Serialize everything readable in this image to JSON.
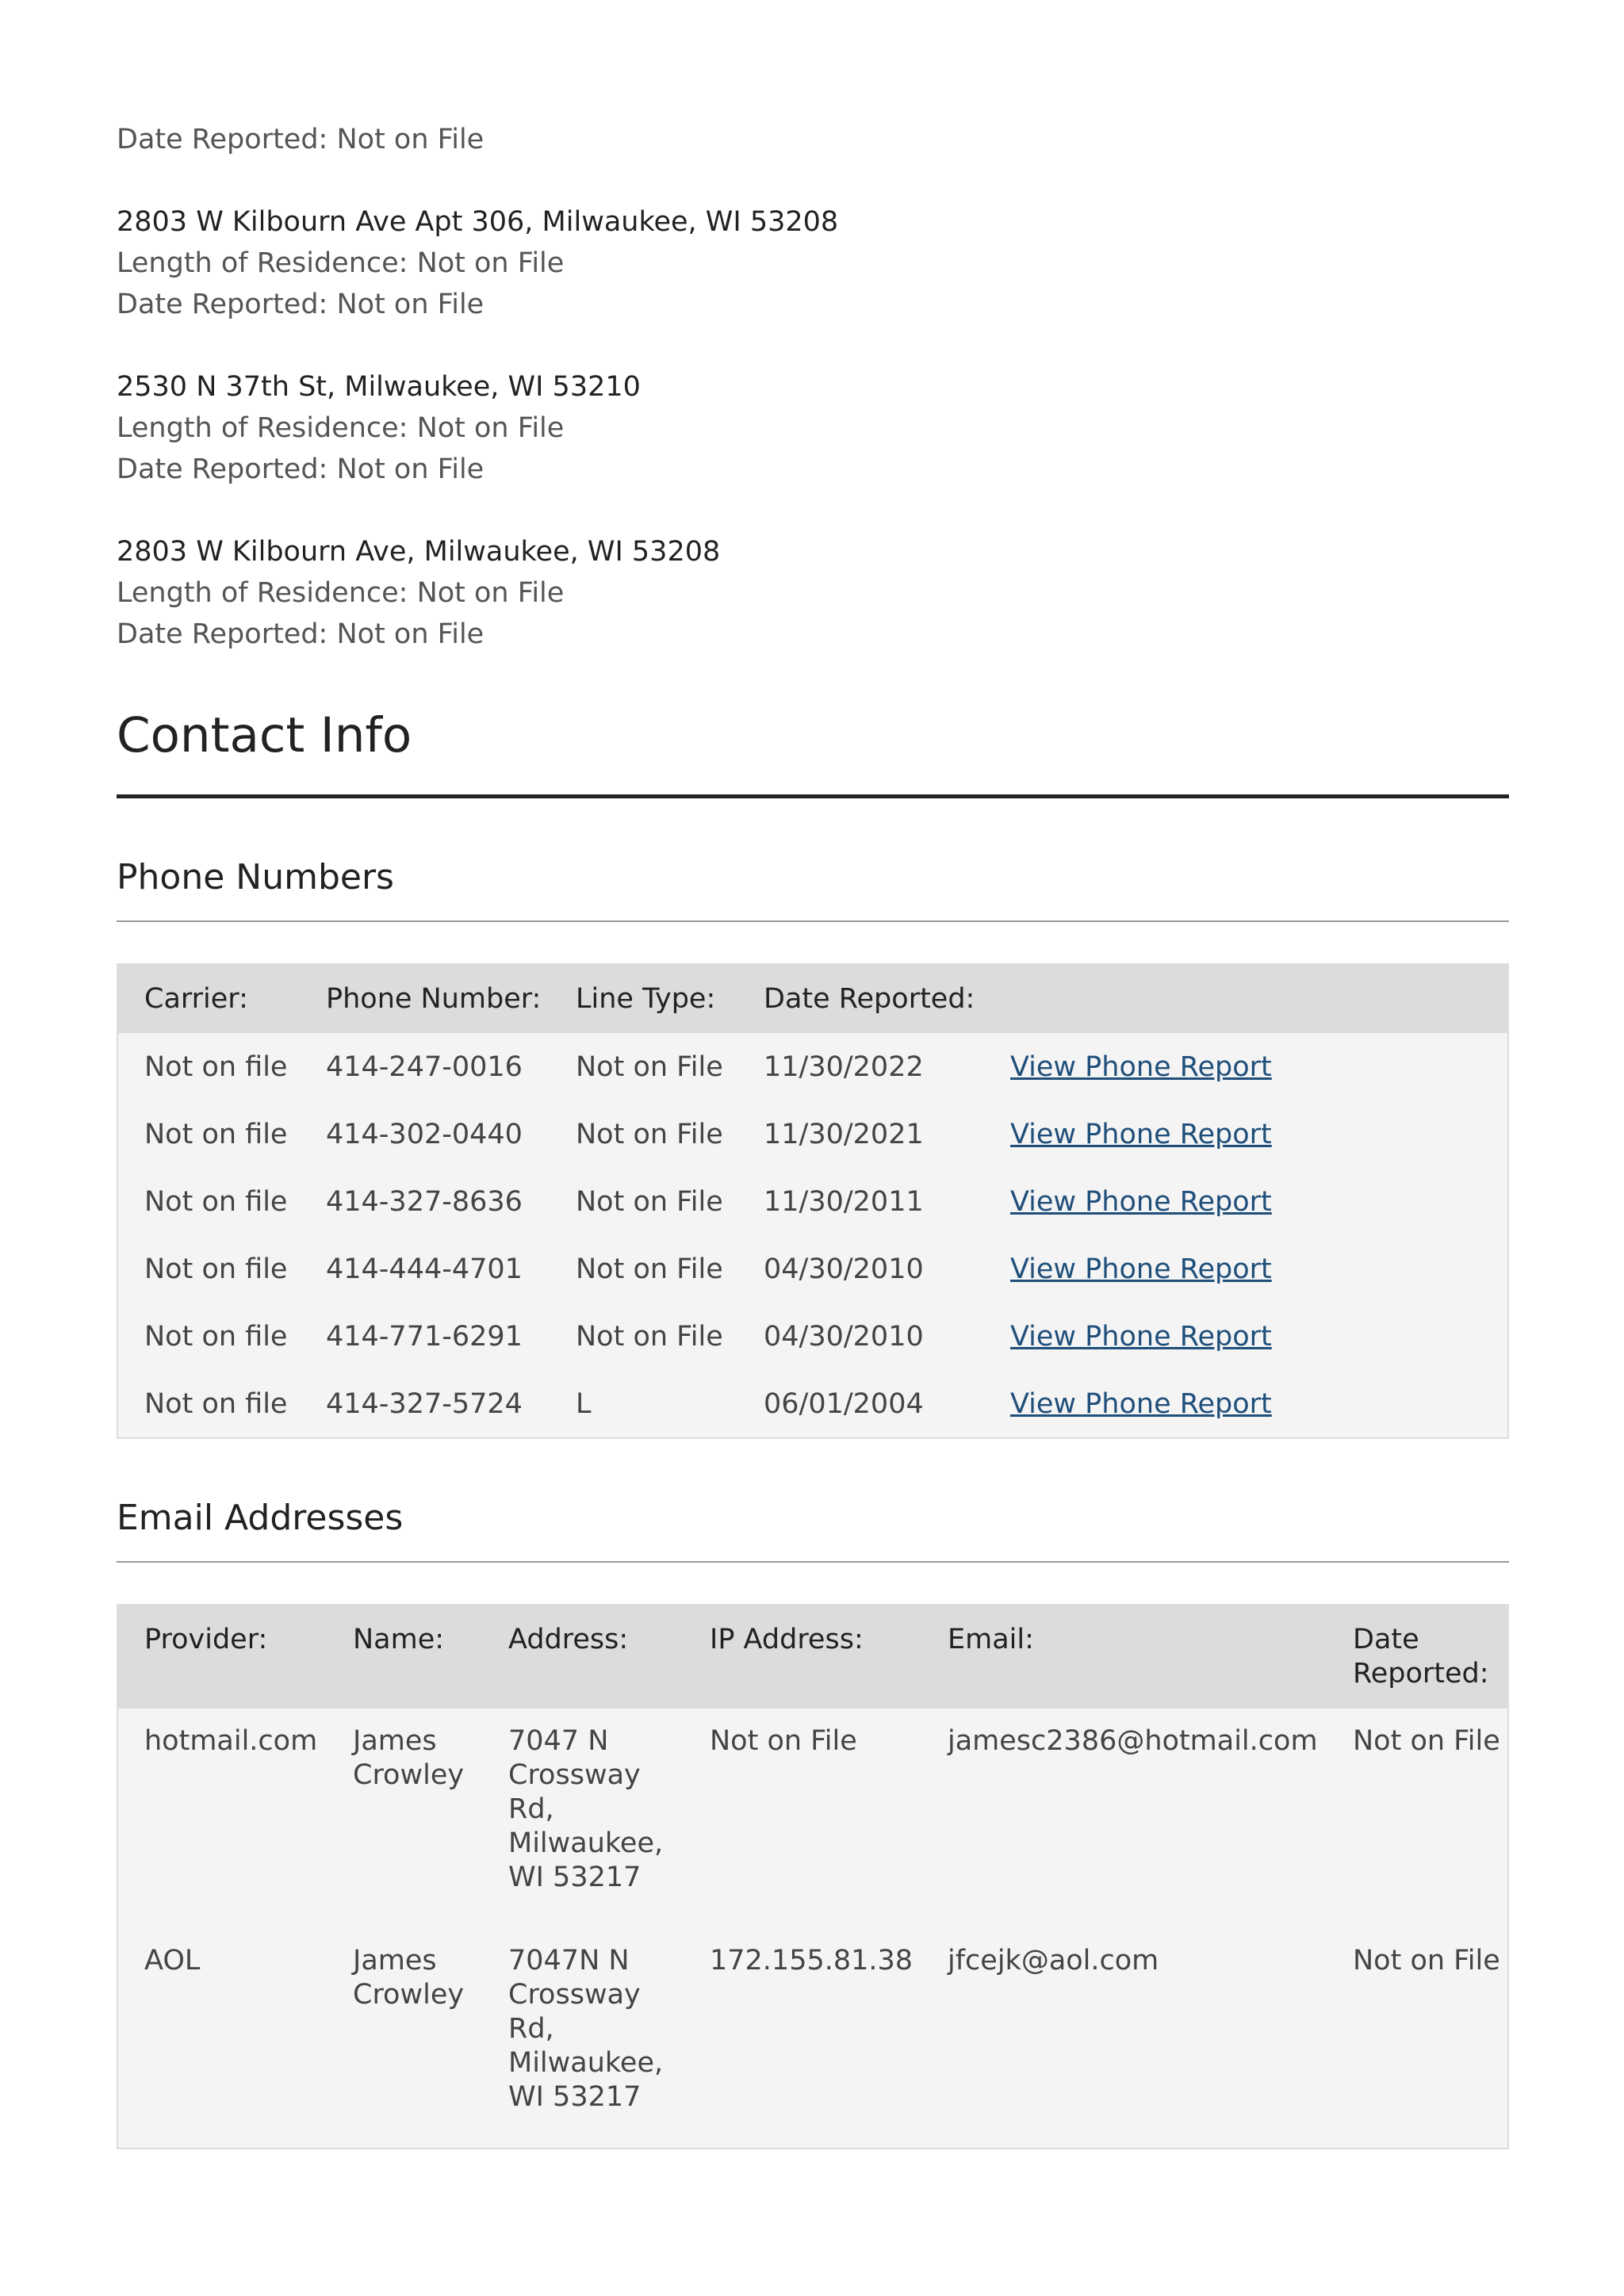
{
  "top_block": {
    "date_reported": "Date Reported: Not on File"
  },
  "addresses": [
    {
      "address": "2803 W Kilbourn Ave Apt 306, Milwaukee, WI 53208",
      "length": "Length of Residence: Not on File",
      "date": "Date Reported: Not on File"
    },
    {
      "address": "2530 N 37th St, Milwaukee, WI 53210",
      "length": "Length of Residence: Not on File",
      "date": "Date Reported: Not on File"
    },
    {
      "address": "2803 W Kilbourn Ave, Milwaukee, WI 53208",
      "length": "Length of Residence: Not on File",
      "date": "Date Reported: Not on File"
    }
  ],
  "contact_info": {
    "title": "Contact Info",
    "phones": {
      "title": "Phone Numbers",
      "headers": [
        "Carrier:",
        "Phone Number:",
        "Line Type:",
        "Date Reported:",
        ""
      ],
      "rows": [
        {
          "carrier": "Not on file",
          "number": "414-247-0016",
          "line_type": "Not on File",
          "date": "11/30/2022",
          "link": "View Phone Report"
        },
        {
          "carrier": "Not on file",
          "number": "414-302-0440",
          "line_type": "Not on File",
          "date": "11/30/2021",
          "link": "View Phone Report"
        },
        {
          "carrier": "Not on file",
          "number": "414-327-8636",
          "line_type": "Not on File",
          "date": "11/30/2011",
          "link": "View Phone Report"
        },
        {
          "carrier": "Not on file",
          "number": "414-444-4701",
          "line_type": "Not on File",
          "date": "04/30/2010",
          "link": "View Phone Report"
        },
        {
          "carrier": "Not on file",
          "number": "414-771-6291",
          "line_type": "Not on File",
          "date": "04/30/2010",
          "link": "View Phone Report"
        },
        {
          "carrier": "Not on file",
          "number": "414-327-5724",
          "line_type": "L",
          "date": "06/01/2004",
          "link": "View Phone Report"
        }
      ]
    },
    "emails": {
      "title": "Email Addresses",
      "headers": [
        "Provider:",
        "Name:",
        "Address:",
        "IP Address:",
        "Email:",
        "Date Reported:"
      ],
      "rows": [
        {
          "provider": "hotmail.com",
          "name": "James Crowley",
          "address": "7047 N Crossway Rd, Milwaukee, WI 53217",
          "ip": "Not on File",
          "email": "jamesc2386@hotmail.com",
          "date": "Not on File"
        },
        {
          "provider": "AOL",
          "name": "James Crowley",
          "address": "7047N N Crossway Rd, Milwaukee, WI 53217",
          "ip": "172.155.81.38",
          "email": "jfcejk@aol.com",
          "date": "Not on File"
        }
      ]
    }
  }
}
